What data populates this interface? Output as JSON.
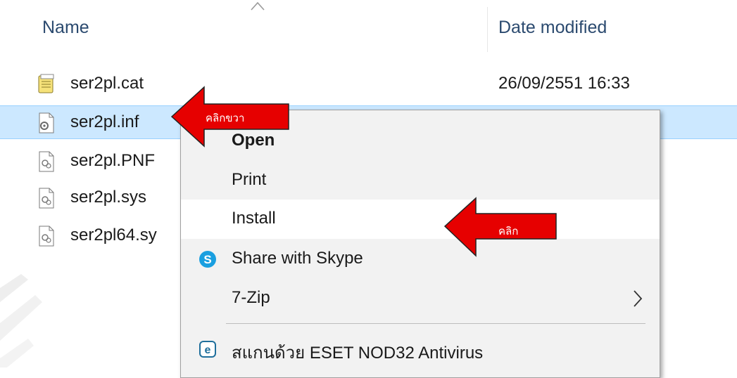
{
  "header": {
    "name_label": "Name",
    "date_label": "Date modified"
  },
  "files": [
    {
      "name": "ser2pl.cat",
      "date": "26/09/2551 16:33",
      "icon": "catalog-file-icon"
    },
    {
      "name": "ser2pl.inf",
      "date": "",
      "icon": "setup-information-file-icon",
      "selected": true
    },
    {
      "name": "ser2pl.PNF",
      "date": "",
      "icon": "system-file-icon"
    },
    {
      "name": "ser2pl.sys",
      "date": "",
      "icon": "system-file-icon"
    },
    {
      "name": "ser2pl64.sy",
      "date": "",
      "icon": "system-file-icon"
    }
  ],
  "context_menu": {
    "items": [
      {
        "label": "Open",
        "bold": true
      },
      {
        "label": "Print"
      },
      {
        "label": "Install",
        "hover": true
      },
      {
        "label": "Share with Skype",
        "icon": "skype-icon"
      },
      {
        "label": "7-Zip",
        "submenu": true
      },
      {
        "label": "สแกนด้วย ESET NOD32 Antivirus",
        "icon": "eset-icon"
      }
    ]
  },
  "annotations": {
    "right_click": "คลิกขวา",
    "click": "คลิก",
    "arrow_color": "#e60000"
  }
}
